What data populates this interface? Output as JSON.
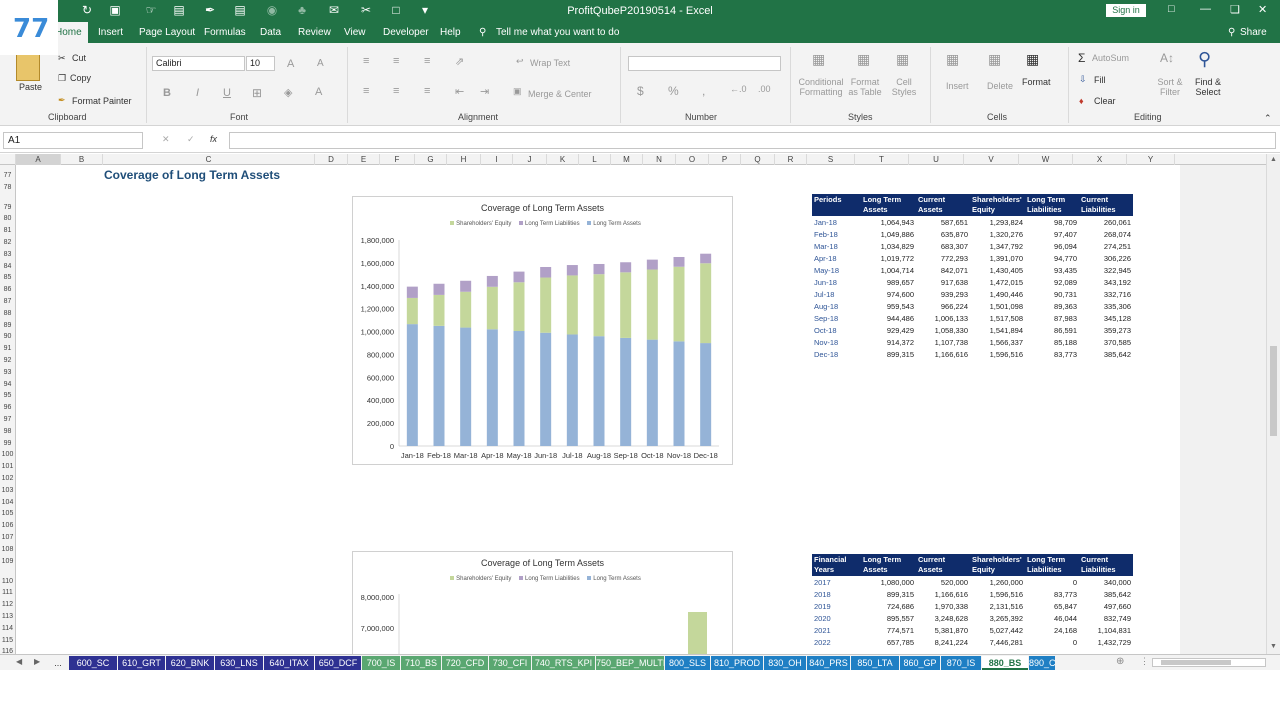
{
  "window": {
    "title": "ProfitQubeP20190514 - Excel",
    "sign_in": "Sign in",
    "share": "Share",
    "logo_text": "77"
  },
  "ribbon_tabs": [
    {
      "label": "Home",
      "x": 0
    },
    {
      "label": "Insert",
      "x": 98
    },
    {
      "label": "Page Layout",
      "x": 139
    },
    {
      "label": "Formulas",
      "x": 204
    },
    {
      "label": "Data",
      "x": 260
    },
    {
      "label": "Review",
      "x": 298
    },
    {
      "label": "View",
      "x": 344
    },
    {
      "label": "Developer",
      "x": 383
    },
    {
      "label": "Help",
      "x": 440
    }
  ],
  "tell_me": "Tell me what you want to do",
  "ribbon": {
    "clipboard": {
      "group": "Clipboard",
      "paste": "Paste",
      "cut": "Cut",
      "copy": "Copy",
      "format_painter": "Format Painter"
    },
    "font": {
      "group": "Font",
      "name": "Calibri",
      "size": "10"
    },
    "alignment": {
      "group": "Alignment",
      "wrap": "Wrap Text",
      "merge": "Merge & Center"
    },
    "number": {
      "group": "Number",
      "format": ""
    },
    "styles": {
      "group": "Styles",
      "cond": "Conditional Formatting",
      "table": "Format as Table",
      "cell": "Cell Styles"
    },
    "cells": {
      "group": "Cells",
      "insert": "Insert",
      "delete": "Delete",
      "format": "Format"
    },
    "editing": {
      "group": "Editing",
      "autosum": "AutoSum",
      "fill": "Fill",
      "clear": "Clear",
      "sort": "Sort & Filter",
      "find": "Find & Select"
    }
  },
  "name_box": "A1",
  "formula": "",
  "columns": [
    "A",
    "B",
    "C",
    "D",
    "E",
    "F",
    "G",
    "H",
    "I",
    "J",
    "K",
    "L",
    "M",
    "N",
    "O",
    "P",
    "Q",
    "R",
    "S",
    "T",
    "U",
    "V",
    "W",
    "X",
    "Y"
  ],
  "rows": [
    "77",
    "78",
    "79",
    "80",
    "81",
    "82",
    "83",
    "84",
    "85",
    "86",
    "87",
    "88",
    "89",
    "90",
    "91",
    "92",
    "93",
    "94",
    "95",
    "96",
    "97",
    "98",
    "99",
    "100",
    "101",
    "102",
    "103",
    "104",
    "105",
    "106",
    "107",
    "108",
    "109",
    "110",
    "111",
    "112",
    "113",
    "114",
    "115",
    "116"
  ],
  "sheet_title": "Coverage of Long Term Assets",
  "colors": {
    "equity": "#c4d79b",
    "ltl": "#b1a0c7",
    "lta": "#95b3d7",
    "header": "#0f2c6b",
    "excel_green": "#217346"
  },
  "chart1": {
    "title": "Coverage of Long Term Assets",
    "legend": [
      "Shareholders' Equity",
      "Long Term Liabilities",
      "Long Term Assets"
    ],
    "y_ticks": [
      "1,800,000",
      "1,600,000",
      "1,400,000",
      "1,200,000",
      "1,000,000",
      "800,000",
      "600,000",
      "400,000",
      "200,000",
      "0"
    ],
    "ymax": 1800000,
    "categories": [
      "Jan-18",
      "Feb-18",
      "Mar-18",
      "Apr-18",
      "May-18",
      "Jun-18",
      "Jul-18",
      "Aug-18",
      "Sep-18",
      "Oct-18",
      "Nov-18",
      "Dec-18"
    ],
    "lta": [
      1064943,
      1049886,
      1034829,
      1019772,
      1004714,
      989657,
      974600,
      959543,
      944486,
      929429,
      914372,
      899315
    ],
    "equity": [
      1293824,
      1320276,
      1347792,
      1391070,
      1430405,
      1472015,
      1490446,
      1501098,
      1517508,
      1541894,
      1566337,
      1596516
    ],
    "ltl": [
      98709,
      97407,
      96094,
      94770,
      93435,
      92089,
      90731,
      89363,
      87983,
      86591,
      85188,
      83773
    ]
  },
  "chart2": {
    "title": "Coverage of Long Term Assets",
    "legend": [
      "Shareholders' Equity",
      "Long Term Liabilities",
      "Long Term Assets"
    ],
    "y_ticks": [
      "8,000,000",
      "7,000,000"
    ]
  },
  "table1": {
    "headers": [
      "Periods",
      "Long Term Assets",
      "Current Assets",
      "Shareholders' Equity",
      "Long Term Liabilities",
      "Current Liabilities"
    ],
    "rows": [
      [
        "Jan-18",
        "1,064,943",
        "587,651",
        "1,293,824",
        "98,709",
        "260,061"
      ],
      [
        "Feb-18",
        "1,049,886",
        "635,870",
        "1,320,276",
        "97,407",
        "268,074"
      ],
      [
        "Mar-18",
        "1,034,829",
        "683,307",
        "1,347,792",
        "96,094",
        "274,251"
      ],
      [
        "Apr-18",
        "1,019,772",
        "772,293",
        "1,391,070",
        "94,770",
        "306,226"
      ],
      [
        "May-18",
        "1,004,714",
        "842,071",
        "1,430,405",
        "93,435",
        "322,945"
      ],
      [
        "Jun-18",
        "989,657",
        "917,638",
        "1,472,015",
        "92,089",
        "343,192"
      ],
      [
        "Jul-18",
        "974,600",
        "939,293",
        "1,490,446",
        "90,731",
        "332,716"
      ],
      [
        "Aug-18",
        "959,543",
        "966,224",
        "1,501,098",
        "89,363",
        "335,306"
      ],
      [
        "Sep-18",
        "944,486",
        "1,006,133",
        "1,517,508",
        "87,983",
        "345,128"
      ],
      [
        "Oct-18",
        "929,429",
        "1,058,330",
        "1,541,894",
        "86,591",
        "359,273"
      ],
      [
        "Nov-18",
        "914,372",
        "1,107,738",
        "1,566,337",
        "85,188",
        "370,585"
      ],
      [
        "Dec-18",
        "899,315",
        "1,166,616",
        "1,596,516",
        "83,773",
        "385,642"
      ]
    ]
  },
  "table2": {
    "headers": [
      "Financial Years",
      "Long Term Assets",
      "Current Assets",
      "Shareholders' Equity",
      "Long Term Liabilities",
      "Current Liabilities"
    ],
    "rows": [
      [
        "2017",
        "1,080,000",
        "520,000",
        "1,260,000",
        "0",
        "340,000"
      ],
      [
        "2018",
        "899,315",
        "1,166,616",
        "1,596,516",
        "83,773",
        "385,642"
      ],
      [
        "2019",
        "724,686",
        "1,970,338",
        "2,131,516",
        "65,847",
        "497,660"
      ],
      [
        "2020",
        "895,557",
        "3,248,628",
        "3,265,392",
        "46,044",
        "832,749"
      ],
      [
        "2021",
        "774,571",
        "5,381,870",
        "5,027,442",
        "24,168",
        "1,104,831"
      ],
      [
        "2022",
        "657,785",
        "8,241,224",
        "7,446,281",
        "0",
        "1,432,729"
      ]
    ]
  },
  "sheet_tabs": [
    {
      "label": "...",
      "color": "#f3f3f3",
      "text": "#333"
    },
    {
      "label": "600_SC",
      "color": "#2e3192",
      "text": "#fff"
    },
    {
      "label": "610_GRT",
      "color": "#2e3192",
      "text": "#fff"
    },
    {
      "label": "620_BNK",
      "color": "#2e3192",
      "text": "#fff"
    },
    {
      "label": "630_LNS",
      "color": "#2e3192",
      "text": "#fff"
    },
    {
      "label": "640_ITAX",
      "color": "#2e3192",
      "text": "#fff"
    },
    {
      "label": "650_DCF",
      "color": "#2e3192",
      "text": "#fff"
    },
    {
      "label": "700_IS",
      "color": "#5aa771",
      "text": "#fff"
    },
    {
      "label": "710_BS",
      "color": "#5aa771",
      "text": "#fff"
    },
    {
      "label": "720_CFD",
      "color": "#5aa771",
      "text": "#fff"
    },
    {
      "label": "730_CFI",
      "color": "#5aa771",
      "text": "#fff"
    },
    {
      "label": "740_RTS_KPI",
      "color": "#5aa771",
      "text": "#fff"
    },
    {
      "label": "750_BEP_MULTI",
      "color": "#5aa771",
      "text": "#fff"
    },
    {
      "label": "800_SLS",
      "color": "#1f7fc4",
      "text": "#fff"
    },
    {
      "label": "810_PROD",
      "color": "#1f7fc4",
      "text": "#fff"
    },
    {
      "label": "830_OH",
      "color": "#1f7fc4",
      "text": "#fff"
    },
    {
      "label": "840_PRS",
      "color": "#1f7fc4",
      "text": "#fff"
    },
    {
      "label": "850_LTA",
      "color": "#1f7fc4",
      "text": "#fff"
    },
    {
      "label": "860_GP",
      "color": "#1f7fc4",
      "text": "#fff"
    },
    {
      "label": "870_IS",
      "color": "#1f7fc4",
      "text": "#fff"
    },
    {
      "label": "880_BS",
      "color": "#ffffff",
      "text": "#217346"
    },
    {
      "label": "890_C",
      "color": "#1f7fc4",
      "text": "#fff"
    }
  ]
}
